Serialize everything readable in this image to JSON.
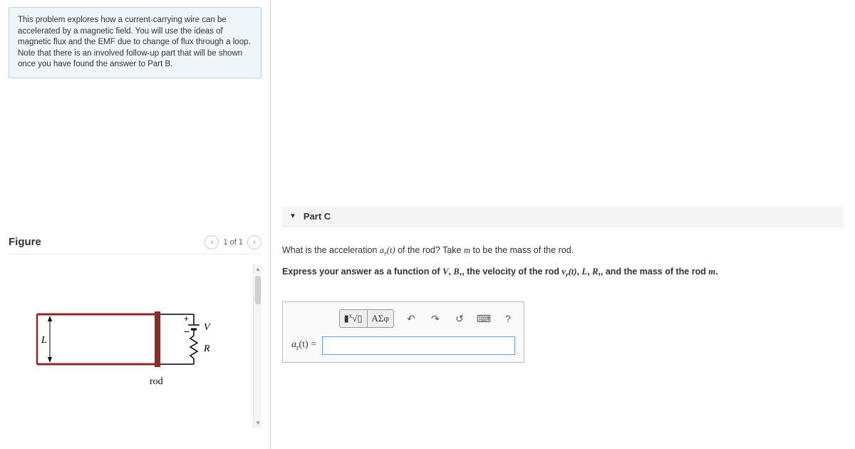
{
  "intro": "This problem explores how a current-carrying wire can be accelerated by a magnetic field. You will use the ideas of magnetic flux and the EMF due to change of flux through a loop. Note that there is an involved follow-up part that will be shown once you have found the answer to Part B.",
  "figure": {
    "title": "Figure",
    "counter": "1 of 1",
    "labels": {
      "L": "L",
      "V": "V",
      "R": "R",
      "rod": "rod",
      "plus": "+",
      "minus": "−"
    }
  },
  "part": {
    "label": "Part C",
    "question_prefix": "What is the acceleration ",
    "ar_t": "aᵣ(t)",
    "question_mid": " of the rod? Take ",
    "m": "m",
    "question_suffix": " to be the mass of the rod.",
    "instruct_prefix": "Express your answer as a function of ",
    "V": "V",
    "B": "B",
    "instruct_mid1": ", the velocity of the rod ",
    "vr_t": "vᵣ(t)",
    "L": "L",
    "R": "R",
    "instruct_mid2": ", and the mass of the rod ",
    "m2": "m",
    "period": "."
  },
  "toolbar": {
    "templates": "▮√▯",
    "greek": "ΑΣφ",
    "help": "?"
  },
  "input": {
    "label_a": "a",
    "label_sub": "r",
    "label_t": "(t) ="
  }
}
